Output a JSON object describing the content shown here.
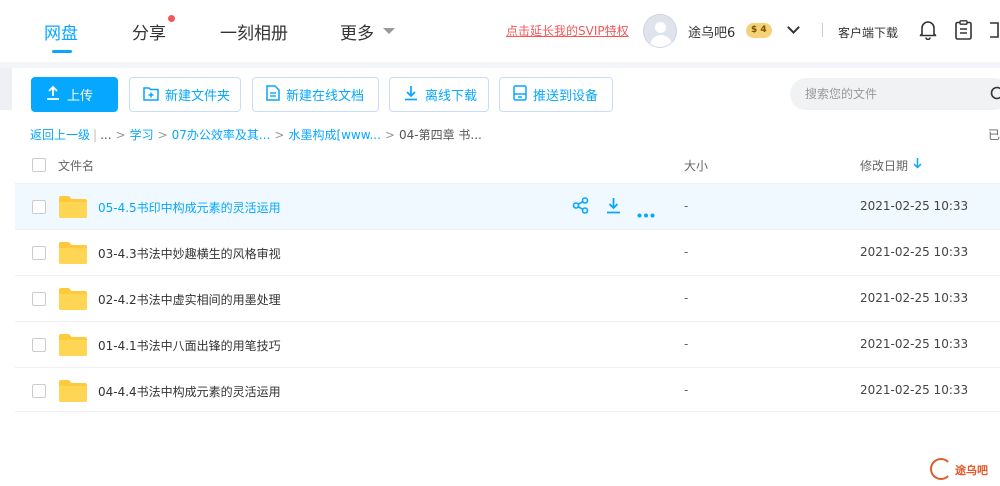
{
  "nav": {
    "tabs": [
      "网盘",
      "分享",
      "一刻相册",
      "更多"
    ],
    "svip_link": "点击延长我的SVIP特权",
    "username": "途乌吧6",
    "vip_level": "$ 4",
    "client_download": "客户端下载"
  },
  "toolbar": {
    "upload": "上传",
    "new_folder": "新建文件夹",
    "new_online_doc": "新建在线文档",
    "offline_download": "离线下载",
    "push_to_device": "推送到设备",
    "search_placeholder": "搜索您的文件"
  },
  "breadcrumb": {
    "back": "返回上一级",
    "ellipsis": "...",
    "items": [
      "学习",
      "07办公效率及其...",
      "水墨构成[www...",
      "04-第四章 书..."
    ],
    "loaded_text": "已"
  },
  "table": {
    "columns": {
      "name": "文件名",
      "size": "大小",
      "modified": "修改日期"
    },
    "rows": [
      {
        "name": "05-4.5书印中构成元素的灵活运用",
        "size": "-",
        "modified": "2021-02-25 10:33",
        "selected": true
      },
      {
        "name": "03-4.3书法中妙趣横生的风格审视",
        "size": "-",
        "modified": "2021-02-25 10:33",
        "selected": false
      },
      {
        "name": "02-4.2书法中虚实相间的用墨处理",
        "size": "-",
        "modified": "2021-02-25 10:33",
        "selected": false
      },
      {
        "name": "01-4.1书法中八面出锋的用笔技巧",
        "size": "-",
        "modified": "2021-02-25 10:33",
        "selected": false
      },
      {
        "name": "04-4.4书法中构成元素的灵活运用",
        "size": "-",
        "modified": "2021-02-25 10:33",
        "selected": false
      }
    ]
  },
  "watermark": "途乌吧",
  "colors": {
    "accent": "#06a7ff",
    "folder": "#ffc93c",
    "svip": "#f25858"
  }
}
